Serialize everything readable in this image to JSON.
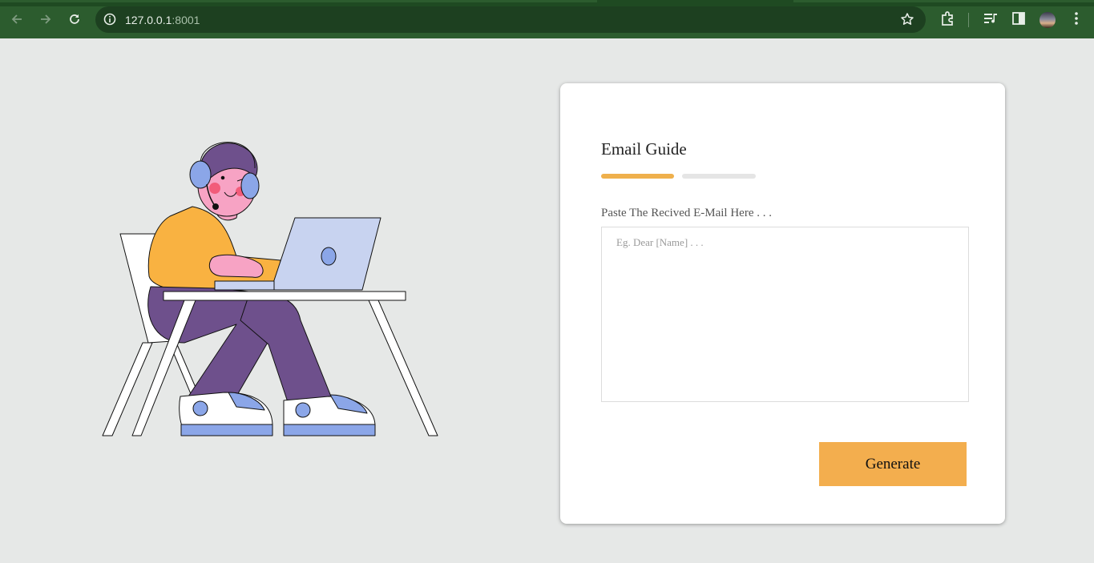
{
  "browser": {
    "url_host": "127.0.0.1",
    "url_port": ":8001",
    "theme_color": "#2c5c2e"
  },
  "card": {
    "title": "Email Guide",
    "steps": [
      {
        "active": true,
        "color": "#efb04c"
      },
      {
        "active": false,
        "color": "#e5e5e5"
      }
    ],
    "field_label": "Paste The Recived E-Mail Here . . .",
    "textarea_value": "",
    "textarea_placeholder": "Eg. Dear [Name] . . .",
    "generate_label": "Generate",
    "accent_color": "#f3ae4e"
  },
  "icons": [
    "back-arrow-icon",
    "forward-arrow-icon",
    "reload-icon",
    "info-icon",
    "star-icon",
    "extensions-icon",
    "media-control-icon",
    "side-panel-icon",
    "more-menu-icon"
  ]
}
